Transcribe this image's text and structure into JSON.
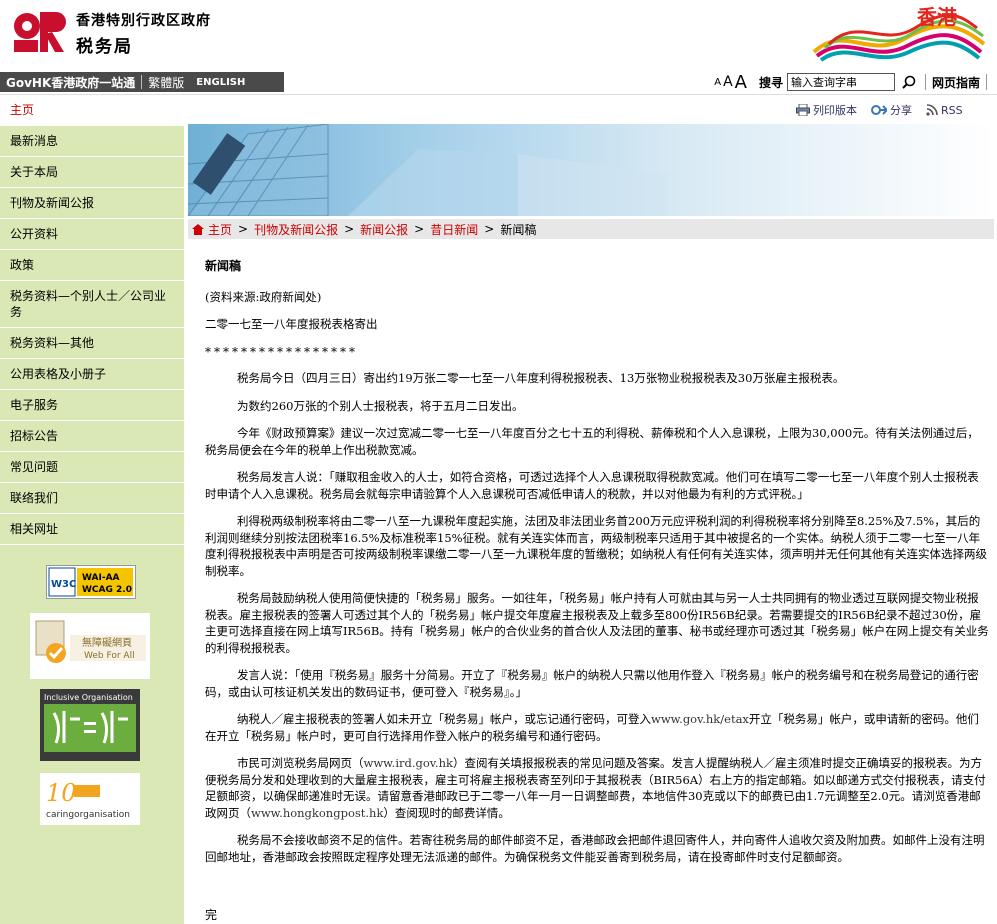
{
  "header": {
    "gov_name": "香港特別行政区政府",
    "dept_name": "税务局",
    "brand_text": "香港"
  },
  "topbar": {
    "govhk": "GovHK",
    "govhk_suffix": "香港政府一站通",
    "traditional": "繁體版",
    "english": "ENGLISH",
    "font_small": "A",
    "font_medium": "A",
    "font_large": "A",
    "search_label": "搜寻",
    "search_placeholder": "输入查询字串",
    "sitemap": "网页指南"
  },
  "sidebar": {
    "items": [
      {
        "label": "主页"
      },
      {
        "label": "最新消息"
      },
      {
        "label": "关于本局"
      },
      {
        "label": "刊物及新闻公报"
      },
      {
        "label": "公开资料"
      },
      {
        "label": "政策"
      },
      {
        "label": "税务资料—个别人士／公司业务"
      },
      {
        "label": "税务资料—其他"
      },
      {
        "label": "公用表格及小册子"
      },
      {
        "label": "电子服务"
      },
      {
        "label": "招标公告"
      },
      {
        "label": "常见问题"
      },
      {
        "label": "联络我们"
      },
      {
        "label": "相关网址"
      }
    ],
    "badges": {
      "w3c": "W3C",
      "wai": "WAI-AA",
      "wcag": "WCAG 2.0",
      "webforall_zh": "無障礙網頁",
      "webforall_en": "Web For All",
      "inclusive": "Inclusive Organisation",
      "caring_num": "10",
      "caring_text": "caringorganisation"
    }
  },
  "toolbox": {
    "print": "列印版本",
    "share": "分享",
    "rss": "RSS"
  },
  "breadcrumb": {
    "items": [
      "主页",
      "刊物及新闻公报",
      "新闻公报",
      "昔日新闻"
    ],
    "current": "新闻稿"
  },
  "article": {
    "title": "新闻稿",
    "source": "(资料来源:政府新闻处)",
    "heading": "二零一七至一八年度报税表格寄出",
    "stars": "*****************",
    "p1": "税务局今日（四月三日）寄出约19万张二零一七至一八年度利得税报税表、13万张物业税报税表及30万张雇主报税表。",
    "p2": "为数约260万张的个别人士报税表，将于五月二日发出。",
    "p3": "今年《财政预算案》建议一次过宽减二零一七至一八年度百分之七十五的利得税、薪俸税和个人入息课税，上限为30,000元。待有关法例通过后，税务局便会在今年的税单上作出税款宽减。",
    "p4": "税务局发言人说：「赚取租金收入的人士，如符合资格，可透过选择个人入息课税取得税款宽减。他们可在填写二零一七至一八年度个别人士报税表时申请个人入息课税。税务局会就每宗申请验算个人入息课税可否减低申请人的税款，并以对他最为有利的方式评税。」",
    "p5": "利得税两级制税率将由二零一八至一九课税年度起实施，法团及非法团业务首200万元应评税利润的利得税税率将分别降至8.25%及7.5%，其后的利润则继续分别按法团税率16.5%及标准税率15%征税。就有关连实体而言，两级制税率只适用于其中被提名的一个实体。纳税人须于二零一七至一八年度利得税报税表中声明是否可按两级制税率课缴二零一八至一九课税年度的暂缴税；如纳税人有任何有关连实体，须声明并无任何其他有关连实体选择两级制税率。",
    "p6": "税务局鼓励纳税人使用简便快捷的「税务易」服务。一如往年，「税务易」帐户持有人可就由其与另一人士共同拥有的物业透过互联网提交物业税报税表。雇主报税表的签署人可透过其个人的「税务易」帐户提交年度雇主报税表及上载多至800份IR56B纪录。若需要提交的IR56B纪录不超过30份，雇主更可选择直接在网上填写IR56B。持有「税务易」帐户的合伙业务的首合伙人及法团的董事、秘书或经理亦可透过其「税务易」帐户在网上提交有关业务的利得税报税表。",
    "p7": "发言人说：「使用『税务易』服务十分简易。开立了『税务易』帐户的纳税人只需以他用作登入『税务易』帐户的税务编号和在税务局登记的通行密码，或由认可核证机关发出的数码证书，便可登入『税务易』。」",
    "p8a": "纳税人／雇主报税表的签署人如未开立「税务易」帐户，或忘记通行密码，可登入",
    "p8link": "www.gov.hk/etax",
    "p8b": "开立「税务易」帐户，或申请新的密码。他们在开立「税务易」帐户时，更可自行选择用作登入帐户的税务编号和通行密码。",
    "p9a": "市民可浏览税务局网页（",
    "p9link1": "www.ird.gov.hk",
    "p9b": "）查阅有关填报报税表的常见问题及答案。发言人提醒纳税人／雇主须准时提交正确填妥的报税表。为方便税务局分发和处理收到的大量雇主报税表，雇主可将雇主报税表寄至列印于其报税表（BIR56A）右上方的指定邮箱。如以邮递方式交付报税表，请支付足额邮资，以确保邮递准时无误。请留意香港邮政已于二零一八年一月一日调整邮费，本地信件30克或以下的邮费已由1.7元调整至2.0元。请浏览香港邮政网页（",
    "p9link2": "www.hongkongpost.hk",
    "p9c": "）查阅现时的邮费详情。",
    "p10": "税务局不会接收邮资不足的信件。若寄往税务局的邮件邮资不足，香港邮政会把邮件退回寄件人，并向寄件人追收欠资及附加费。如邮件上没有注明回邮地址，香港邮政会按照既定程序处理无法派递的邮件。为确保税务文件能妥善寄到税务局，请在投寄邮件时支付足额邮资。",
    "end": "完"
  },
  "colors": {
    "logo_red": "#c8102e",
    "sidebar_bg": "#d9e8b5",
    "active_red": "#cc0000",
    "gov_bar": "#4a4a4a"
  }
}
